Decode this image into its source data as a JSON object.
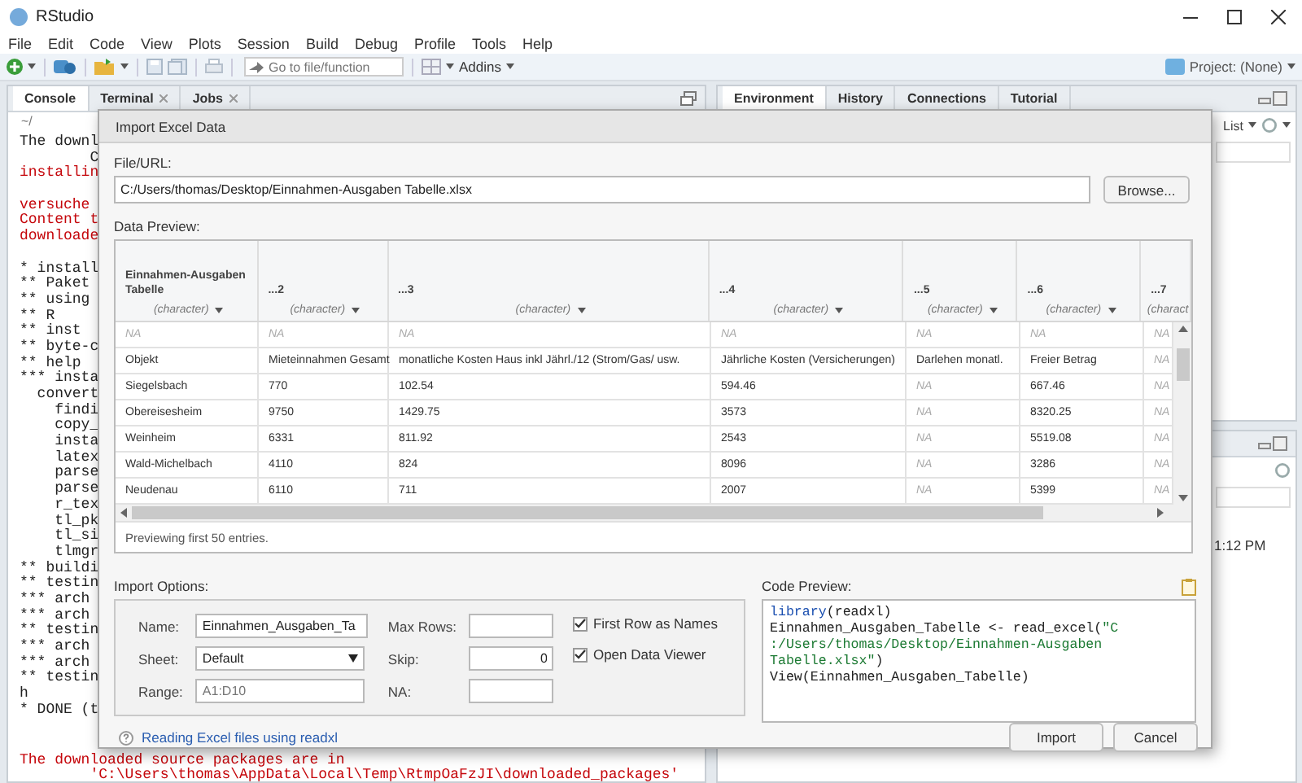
{
  "window": {
    "title": "RStudio"
  },
  "menu": [
    "File",
    "Edit",
    "Code",
    "View",
    "Plots",
    "Session",
    "Build",
    "Debug",
    "Profile",
    "Tools",
    "Help"
  ],
  "toolbar": {
    "goto_placeholder": "Go to file/function",
    "addins": "Addins",
    "project": "Project: (None)"
  },
  "console_pane": {
    "tabs": [
      {
        "label": "Console",
        "selected": true,
        "closable": false
      },
      {
        "label": "Terminal",
        "selected": false,
        "closable": true
      },
      {
        "label": "Jobs",
        "selected": false,
        "closable": true
      }
    ],
    "path": "~/",
    "lines_beside_dialog": [
      {
        "text": "The downl",
        "kind": "output"
      },
      {
        "text": "        C",
        "kind": "output"
      },
      {
        "text": "installin",
        "kind": "message"
      },
      {
        "kind": "blank"
      },
      {
        "text": "versuche",
        "kind": "message"
      },
      {
        "text": "Content t",
        "kind": "message"
      },
      {
        "text": "downloade",
        "kind": "message"
      },
      {
        "kind": "blank"
      },
      {
        "text": "* install",
        "kind": "output"
      },
      {
        "text": "** Paket",
        "kind": "output"
      },
      {
        "text": "** using",
        "kind": "output"
      },
      {
        "text": "** R",
        "kind": "output"
      },
      {
        "text": "** inst",
        "kind": "output"
      },
      {
        "text": "** byte-c",
        "kind": "output"
      },
      {
        "text": "** help",
        "kind": "output"
      },
      {
        "text": "*** insta",
        "kind": "output"
      },
      {
        "text": "  convert",
        "kind": "output"
      },
      {
        "text": "    findi",
        "kind": "output"
      },
      {
        "text": "    copy_",
        "kind": "output"
      },
      {
        "text": "    insta",
        "kind": "output"
      },
      {
        "text": "    latex",
        "kind": "output"
      },
      {
        "text": "    parse",
        "kind": "output"
      },
      {
        "text": "    parse",
        "kind": "output"
      },
      {
        "text": "    r_tex",
        "kind": "output"
      },
      {
        "text": "    tl_pk",
        "kind": "output"
      },
      {
        "text": "    tl_si",
        "kind": "output"
      },
      {
        "text": "    tlmgr",
        "kind": "output"
      },
      {
        "text": "** buildi",
        "kind": "output"
      },
      {
        "text": "** testin",
        "kind": "output"
      },
      {
        "text": "*** arch",
        "kind": "output"
      },
      {
        "text": "*** arch",
        "kind": "output"
      },
      {
        "text": "** testin",
        "kind": "output"
      },
      {
        "text": "*** arch",
        "kind": "output"
      },
      {
        "text": "*** arch",
        "kind": "output"
      },
      {
        "text": "** testin",
        "kind": "output"
      },
      {
        "text": "h",
        "kind": "output"
      },
      {
        "text": "* DONE (t",
        "kind": "output"
      },
      {
        "kind": "blank"
      }
    ],
    "lines_below_dialog": [
      {
        "text": "The downloaded source packages are in",
        "kind": "message"
      },
      {
        "text": "        'C:\\Users\\thomas\\AppData\\Local\\Temp\\RtmpOaFzJI\\downloaded_packages'",
        "kind": "message"
      }
    ]
  },
  "environment_pane": {
    "tabs": [
      {
        "label": "Environment",
        "selected": true
      },
      {
        "label": "History",
        "selected": false
      },
      {
        "label": "Connections",
        "selected": false
      },
      {
        "label": "Tutorial",
        "selected": false
      }
    ],
    "view_mode": "List"
  },
  "files_pane": {
    "time": "1:12 PM"
  },
  "dialog": {
    "title": "Import Excel Data",
    "file_label": "File/URL:",
    "file_value": "C:/Users/thomas/Desktop/Einnahmen-Ausgaben Tabelle.xlsx",
    "browse_button": "Browse...",
    "preview_label": "Data Preview:",
    "table": {
      "columns": [
        {
          "name": "Einnahmen-Ausgaben Tabelle",
          "type": "(character)"
        },
        {
          "name": "...2",
          "type": "(character)"
        },
        {
          "name": "...3",
          "type": "(character)"
        },
        {
          "name": "...4",
          "type": "(character)"
        },
        {
          "name": "...5",
          "type": "(character)"
        },
        {
          "name": "...6",
          "type": "(character)"
        },
        {
          "name": "...7",
          "type": "(charact"
        }
      ],
      "rows": [
        [
          {
            "text": "NA",
            "missing": true
          },
          {
            "text": "NA",
            "missing": true
          },
          {
            "text": "NA",
            "missing": true
          },
          {
            "text": "NA",
            "missing": true
          },
          {
            "text": "NA",
            "missing": true
          },
          {
            "text": "NA",
            "missing": true
          },
          {
            "text": "NA",
            "missing": true
          }
        ],
        [
          {
            "text": "Objekt",
            "missing": false
          },
          {
            "text": "Mieteinnahmen Gesamt",
            "missing": false
          },
          {
            "text": "monatliche Kosten Haus inkl Jährl./12  (Strom/Gas/ usw.",
            "missing": false
          },
          {
            "text": "Jährliche Kosten (Versicherungen)",
            "missing": false
          },
          {
            "text": "Darlehen monatl.",
            "missing": false
          },
          {
            "text": "Freier Betrag",
            "missing": false
          },
          {
            "text": "NA",
            "missing": true
          }
        ],
        [
          {
            "text": "Siegelsbach",
            "missing": false
          },
          {
            "text": "770",
            "missing": false
          },
          {
            "text": "102.54",
            "missing": false
          },
          {
            "text": "594.46",
            "missing": false
          },
          {
            "text": "NA",
            "missing": true
          },
          {
            "text": "667.46",
            "missing": false
          },
          {
            "text": "NA",
            "missing": true
          }
        ],
        [
          {
            "text": "Obereisesheim",
            "missing": false
          },
          {
            "text": "9750",
            "missing": false
          },
          {
            "text": "1429.75",
            "missing": false
          },
          {
            "text": "3573",
            "missing": false
          },
          {
            "text": "NA",
            "missing": true
          },
          {
            "text": "8320.25",
            "missing": false
          },
          {
            "text": "NA",
            "missing": true
          }
        ],
        [
          {
            "text": "Weinheim",
            "missing": false
          },
          {
            "text": "6331",
            "missing": false
          },
          {
            "text": "811.92",
            "missing": false
          },
          {
            "text": "2543",
            "missing": false
          },
          {
            "text": "NA",
            "missing": true
          },
          {
            "text": "5519.08",
            "missing": false
          },
          {
            "text": "NA",
            "missing": true
          }
        ],
        [
          {
            "text": "Wald-Michelbach",
            "missing": false
          },
          {
            "text": "4110",
            "missing": false
          },
          {
            "text": "824",
            "missing": false
          },
          {
            "text": "8096",
            "missing": false
          },
          {
            "text": "NA",
            "missing": true
          },
          {
            "text": "3286",
            "missing": false
          },
          {
            "text": "NA",
            "missing": true
          }
        ],
        [
          {
            "text": "Neudenau",
            "missing": false
          },
          {
            "text": "6110",
            "missing": false
          },
          {
            "text": "711",
            "missing": false
          },
          {
            "text": "2007",
            "missing": false
          },
          {
            "text": "NA",
            "missing": true
          },
          {
            "text": "5399",
            "missing": false
          },
          {
            "text": "NA",
            "missing": true
          }
        ]
      ],
      "footer": "Previewing first 50 entries."
    },
    "options_label": "Import Options:",
    "options": {
      "name": {
        "label": "Name:",
        "value": "Einnahmen_Ausgaben_Ta"
      },
      "sheet": {
        "label": "Sheet:",
        "value": "Default"
      },
      "range": {
        "label": "Range:",
        "placeholder": "A1:D10"
      },
      "max_rows": {
        "label": "Max Rows:"
      },
      "skip": {
        "label": "Skip:",
        "value": "0"
      },
      "na": {
        "label": "NA:"
      },
      "checkboxes": [
        {
          "label": "First Row as Names",
          "checked": true
        },
        {
          "label": "Open Data Viewer",
          "checked": true
        }
      ]
    },
    "code_label": "Code Preview:",
    "code_lines": [
      [
        {
          "text": "library",
          "kind": "function"
        },
        {
          "text": "(readxl)",
          "kind": "plain"
        }
      ],
      [
        {
          "text": "Einnahmen_Ausgaben_Tabelle <- read_excel(",
          "kind": "plain"
        },
        {
          "text": "\"C",
          "kind": "string"
        }
      ],
      [
        {
          "text": ":/Users/thomas/Desktop/Einnahmen-Ausgaben",
          "kind": "string"
        }
      ],
      [
        {
          "text": "Tabelle.xlsx\"",
          "kind": "string"
        },
        {
          "text": ")",
          "kind": "plain"
        }
      ],
      [
        {
          "text": "View(Einnahmen_Ausgaben_Tabelle)",
          "kind": "plain"
        }
      ]
    ],
    "help_link": "Reading Excel files using readxl",
    "buttons": [
      {
        "label": "Import",
        "kind": "default"
      },
      {
        "label": "Cancel",
        "kind": "cancel"
      }
    ]
  }
}
